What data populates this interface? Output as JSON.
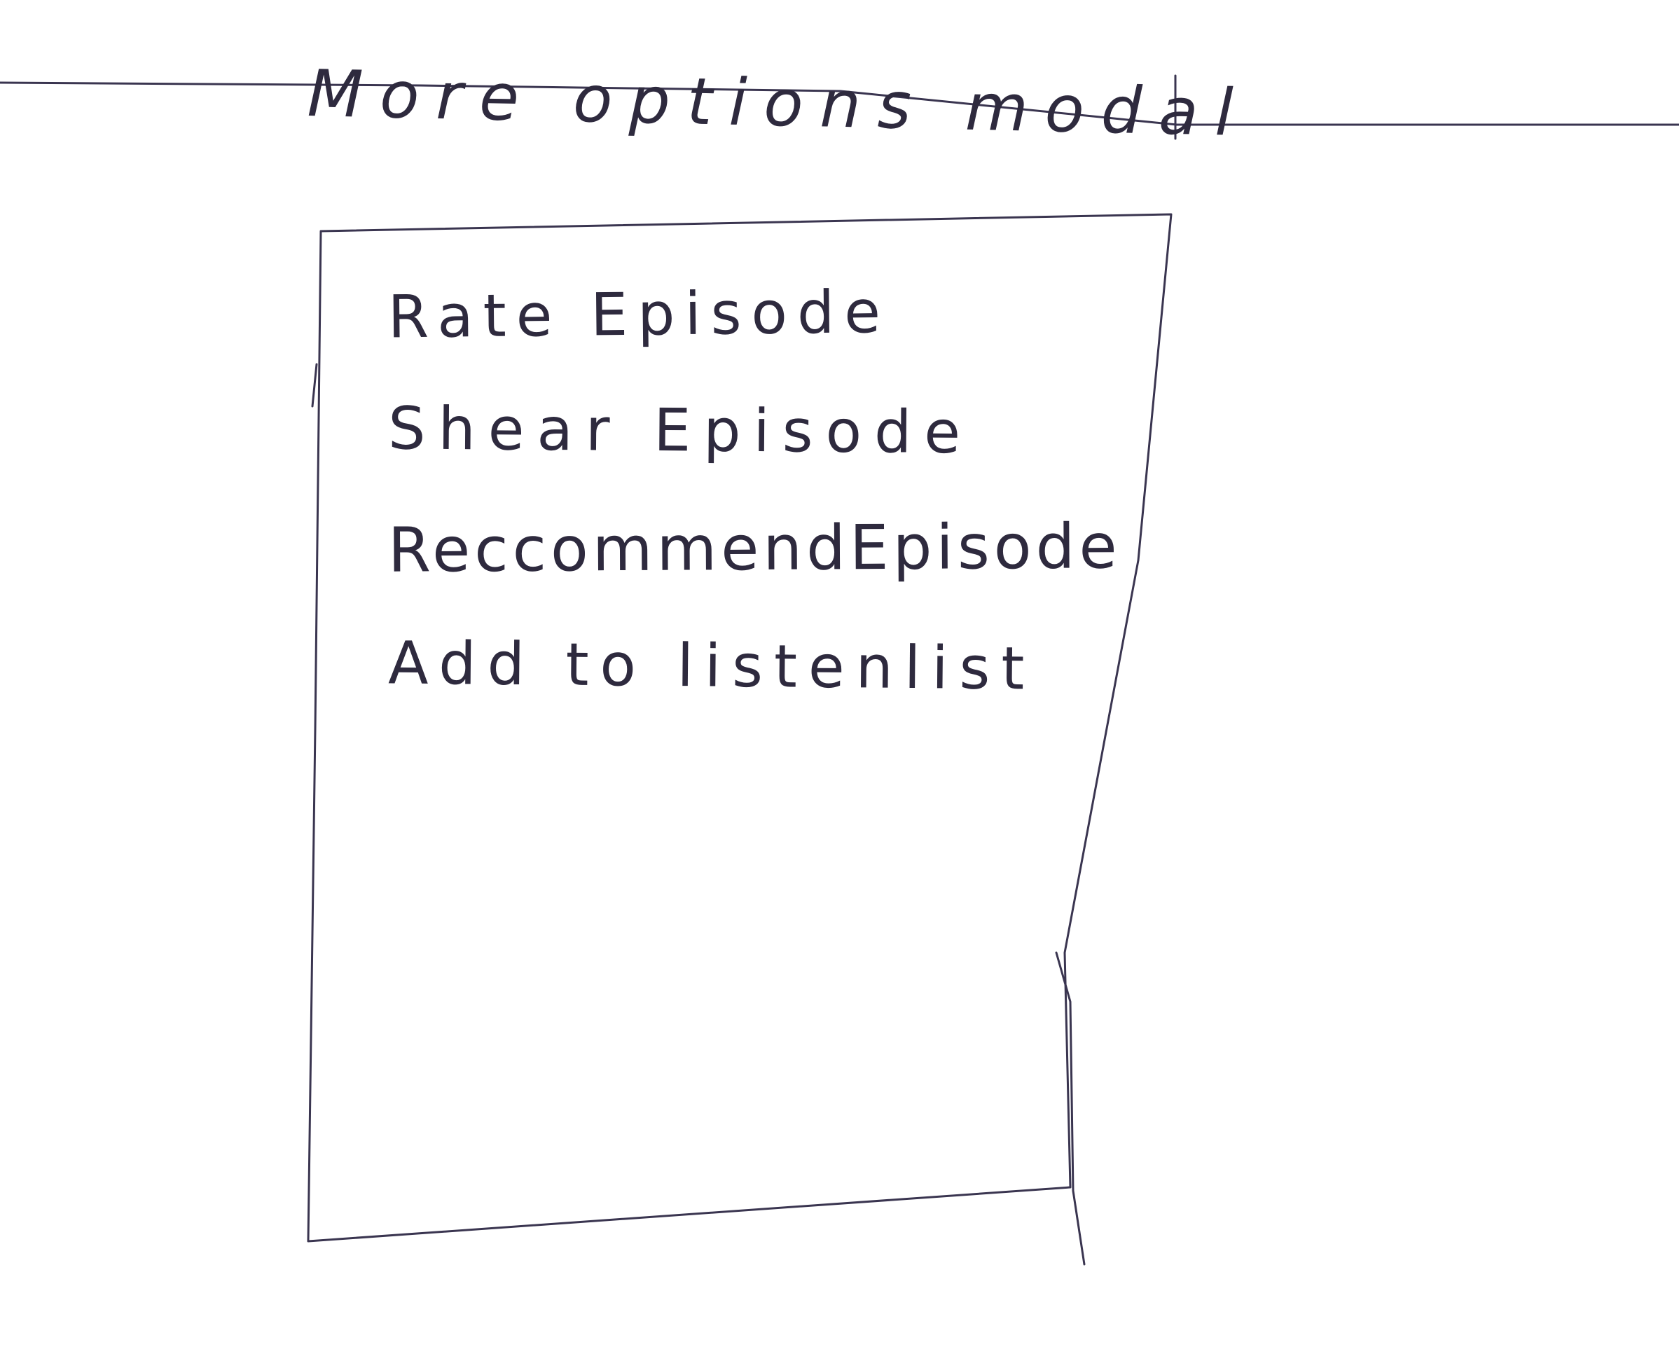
{
  "page": {
    "title": "More options modal"
  },
  "modal": {
    "items": [
      {
        "label": "Rate Episode"
      },
      {
        "label": "Shear Episode"
      },
      {
        "label": "ReccommendEpisode"
      },
      {
        "label": "Add to listenlist"
      }
    ]
  }
}
